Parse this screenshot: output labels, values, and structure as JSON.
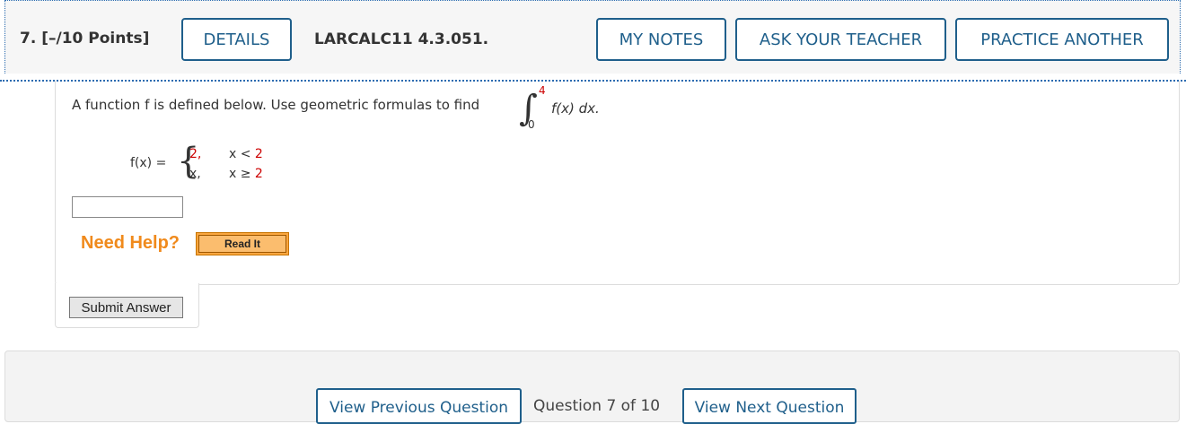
{
  "header": {
    "question_number": "7.",
    "points": "[–/10 Points]",
    "details_label": "DETAILS",
    "question_id": "LARCALC11 4.3.051.",
    "my_notes_label": "MY NOTES",
    "ask_teacher_label": "ASK YOUR TEACHER",
    "practice_another_label": "PRACTICE ANOTHER"
  },
  "question": {
    "prompt": "A function f is defined below. Use geometric formulas to find",
    "integral": {
      "upper_limit": "4",
      "lower_limit": "0",
      "integrand": "f(x) dx."
    },
    "function_label": "f(x) =",
    "cases": [
      {
        "value": "2,",
        "condition": "x < 2"
      },
      {
        "value": "x,",
        "condition": "x ≥ 2"
      }
    ],
    "answer_value": ""
  },
  "help": {
    "need_help_label": "Need Help?",
    "read_it_label": "Read It"
  },
  "submit_label": "Submit Answer",
  "navigation": {
    "previous_label": "View Previous Question",
    "counter": "Question 7 of 10",
    "next_label": "View Next Question"
  },
  "colors": {
    "accent": "#1f5f8b",
    "highlight_red": "#cc0000",
    "help_orange": "#f08a1c"
  }
}
